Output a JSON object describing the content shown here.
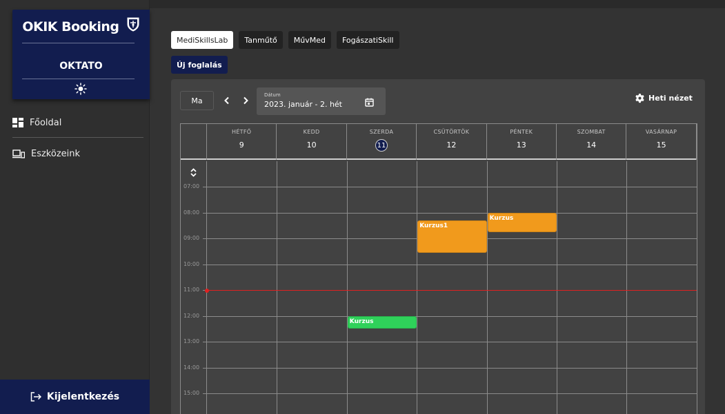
{
  "sidebar": {
    "brand_title": "OKIK Booking",
    "role": "OKTATO",
    "nav": [
      {
        "label": "Főoldal"
      },
      {
        "label": "Eszközeink"
      }
    ],
    "logout_label": "Kijelentkezés"
  },
  "resources": {
    "tabs": [
      {
        "label": "MediSkillsLab",
        "active": true
      },
      {
        "label": "Tanműtő",
        "active": false
      },
      {
        "label": "MűvMed",
        "active": false
      },
      {
        "label": "FogászatiSkill",
        "active": false
      }
    ],
    "new_booking_label": "Új foglalás"
  },
  "toolbar": {
    "today_label": "Ma",
    "date_label": "Dátum",
    "date_value": "2023. január - 2. hét",
    "view_label": "Heti nézet"
  },
  "calendar": {
    "days": [
      {
        "name": "HÉTFŐ",
        "num": "9",
        "today": false
      },
      {
        "name": "KEDD",
        "num": "10",
        "today": false
      },
      {
        "name": "SZERDA",
        "num": "11",
        "today": true
      },
      {
        "name": "CSÜTÖRTÖK",
        "num": "12",
        "today": false
      },
      {
        "name": "PÉNTEK",
        "num": "13",
        "today": false
      },
      {
        "name": "SZOMBAT",
        "num": "14",
        "today": false
      },
      {
        "name": "VASÁRNAP",
        "num": "15",
        "today": false
      }
    ],
    "hours": [
      "07:00",
      "08:00",
      "09:00",
      "10:00",
      "11:00",
      "12:00",
      "13:00",
      "14:00",
      "15:00"
    ],
    "now_hour": 11.0,
    "events": [
      {
        "title": "Kurzus",
        "day": 2,
        "start": 12.0,
        "end": 12.5,
        "color": "#2fd15a"
      },
      {
        "title": "Kurzus1",
        "day": 3,
        "start": 8.3,
        "end": 9.55,
        "color": "#f19a1c"
      },
      {
        "title": "Kurzus",
        "day": 4,
        "start": 8.0,
        "end": 8.75,
        "color": "#f19a1c"
      }
    ]
  },
  "colors": {
    "brand_navy": "#121d4f",
    "event_orange": "#f19a1c",
    "event_green": "#2fd15a",
    "now_red": "#e02020"
  }
}
